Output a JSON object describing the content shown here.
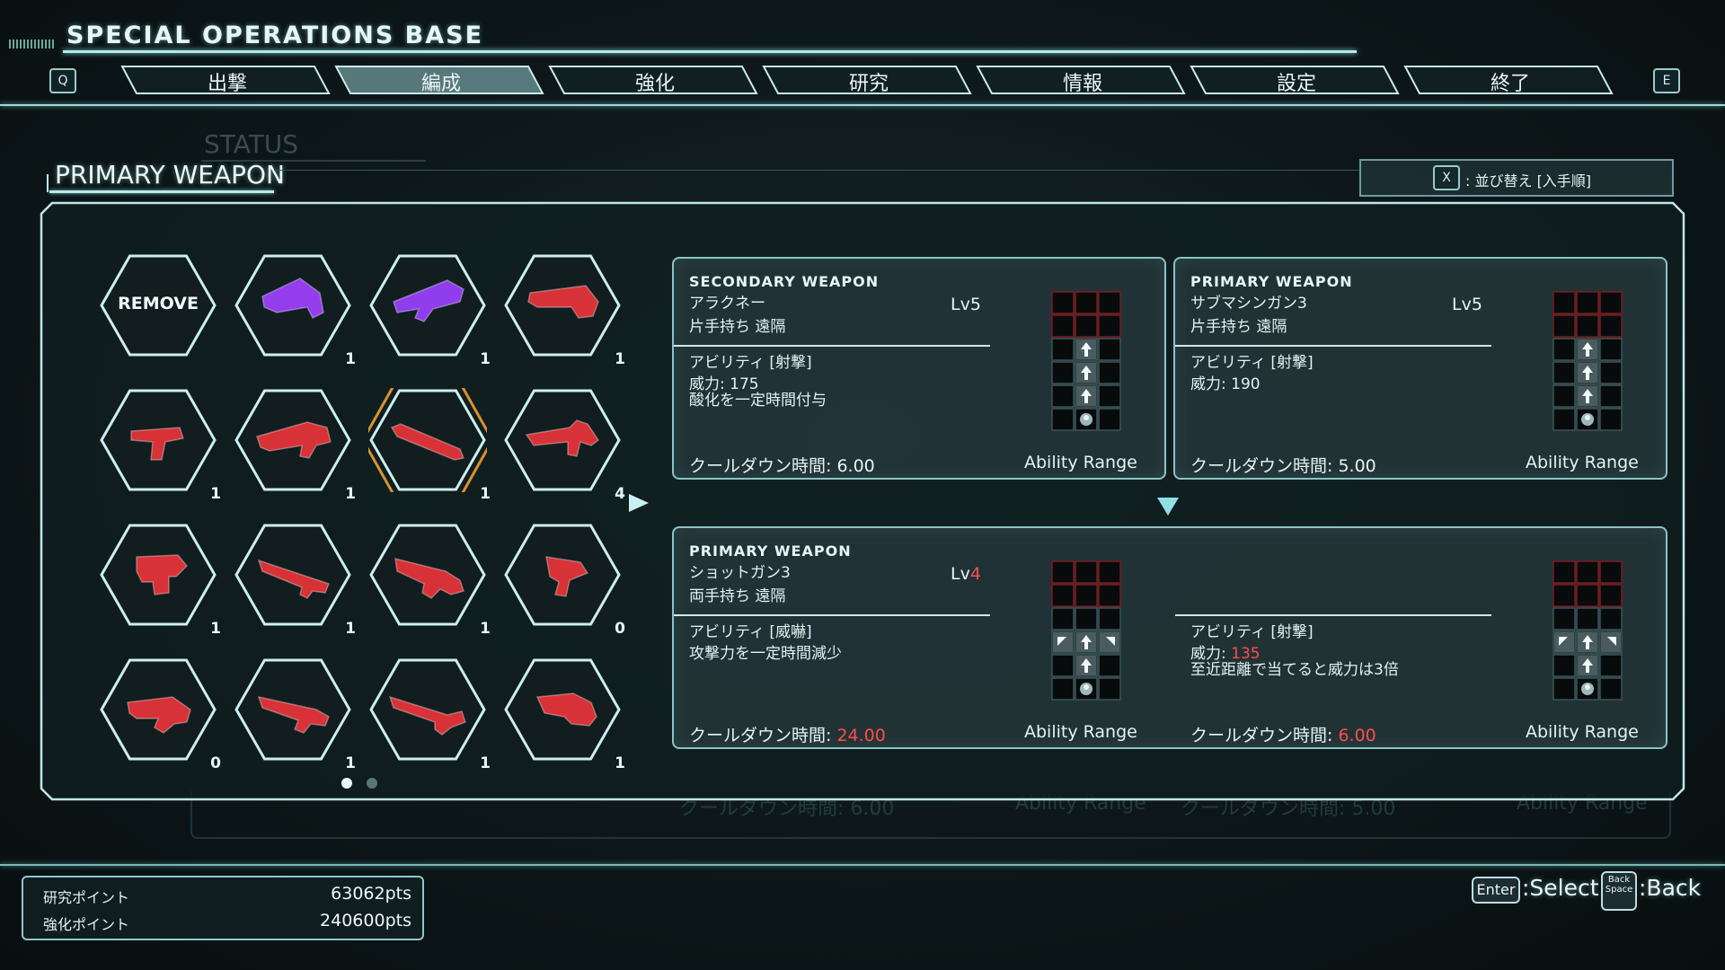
{
  "header": {
    "title": "SPECIAL OPERATIONS BASE",
    "left_key": "Q",
    "right_key": "E",
    "tabs": [
      {
        "label": "出撃",
        "active": false
      },
      {
        "label": "編成",
        "active": true
      },
      {
        "label": "強化",
        "active": false
      },
      {
        "label": "研究",
        "active": false
      },
      {
        "label": "情報",
        "active": false
      },
      {
        "label": "設定",
        "active": false
      },
      {
        "label": "終了",
        "active": false
      }
    ]
  },
  "section": {
    "ghost_title": "STATUS",
    "title": "PRIMARY WEAPON",
    "sort_key": "X",
    "sort_label": ": 並び替え [入手順]"
  },
  "weapon_grid": {
    "remove_label": "REMOVE",
    "items": [
      {
        "icon": "remove-slot",
        "count": null,
        "color": null,
        "selected": false
      },
      {
        "icon": "acid-launcher-icon",
        "count": "1",
        "color": "#a040ff",
        "selected": false
      },
      {
        "icon": "plasma-rifle-icon",
        "count": "1",
        "color": "#9a40ff",
        "selected": false
      },
      {
        "icon": "heavy-launcher-icon",
        "count": "1",
        "color": "#e8343a",
        "selected": false
      },
      {
        "icon": "pistol-icon",
        "count": "1",
        "color": "#e8343a",
        "selected": false
      },
      {
        "icon": "assault-rifle-icon",
        "count": "1",
        "color": "#e8343a",
        "selected": false
      },
      {
        "icon": "shotgun-icon",
        "count": "1",
        "color": "#e8343a",
        "selected": true
      },
      {
        "icon": "sniper-rifle-icon",
        "count": "4",
        "color": "#e8343a",
        "selected": false
      },
      {
        "icon": "heavy-pistol-icon",
        "count": "1",
        "color": "#e8343a",
        "selected": false
      },
      {
        "icon": "battle-rifle-icon",
        "count": "1",
        "color": "#e8343a",
        "selected": false
      },
      {
        "icon": "bullpup-rifle-icon",
        "count": "1",
        "color": "#e8343a",
        "selected": false
      },
      {
        "icon": "smg-icon",
        "count": "0",
        "color": "#e8343a",
        "selected": false
      },
      {
        "icon": "machine-pistol-icon",
        "count": "0",
        "color": "#e8343a",
        "selected": false
      },
      {
        "icon": "carbine-icon",
        "count": "1",
        "color": "#e8343a",
        "selected": false
      },
      {
        "icon": "scoped-rifle-icon",
        "count": "1",
        "color": "#e8343a",
        "selected": false
      },
      {
        "icon": "grenade-launcher-icon",
        "count": "1",
        "color": "#e8343a",
        "selected": false
      }
    ],
    "page_count": 2,
    "current_page": 1
  },
  "cards": {
    "secondary": {
      "header": "SECONDARY WEAPON",
      "name": "アラクネー",
      "level": "Lv5",
      "type": "片手持ち 遠隔",
      "ability": "アビリティ [射撃]",
      "power": "威力: 175",
      "effect": "酸化を一定時間付与",
      "cooldown_label": "クールダウン時間: ",
      "cooldown_value": "6.00",
      "range_label": "Ability Range"
    },
    "primary_current": {
      "header": "PRIMARY WEAPON",
      "name": "サブマシンガン3",
      "level": "Lv5",
      "type": "片手持ち 遠隔",
      "ability": "アビリティ [射撃]",
      "power": "威力: 190",
      "cooldown_label": "クールダウン時間: ",
      "cooldown_value": "5.00",
      "range_label": "Ability Range"
    },
    "primary_new": {
      "header": "PRIMARY WEAPON",
      "name": "ショットガン3",
      "level_prefix": "Lv",
      "level_value": "4",
      "type": "両手持ち 遠隔",
      "ability_left": "アビリティ [威嚇]",
      "effect_left": "攻撃力を一定時間減少",
      "cooldown_label": "クールダウン時間: ",
      "cooldown_left": "24.00",
      "range_label": "Ability Range",
      "ability_right": "アビリティ [射撃]",
      "power_prefix": "威力: ",
      "power_value": "135",
      "effect_right": "至近距離で当てると威力は3倍",
      "cooldown_right": "6.00"
    }
  },
  "ghost_row": {
    "left_cooldown": "クールダウン時間: 6.00",
    "left_range": "Ability Range",
    "right_cooldown": "クールダウン時間: 5.00",
    "right_range": "Ability Range"
  },
  "footer": {
    "research_label": "研究ポイント",
    "research_value": "63062pts",
    "enhance_label": "強化ポイント",
    "enhance_value": "240600pts",
    "select_key": "Enter",
    "select_label": ":Select",
    "back_key_line1": "Back",
    "back_key_line2": "Space",
    "back_label": ":Back"
  },
  "colors": {
    "accent": "#bfe9e9",
    "highlight": "#ff4d4d",
    "selected_border": "#f0a030",
    "weapon_red": "#e8343a",
    "weapon_purple": "#a040ff"
  }
}
